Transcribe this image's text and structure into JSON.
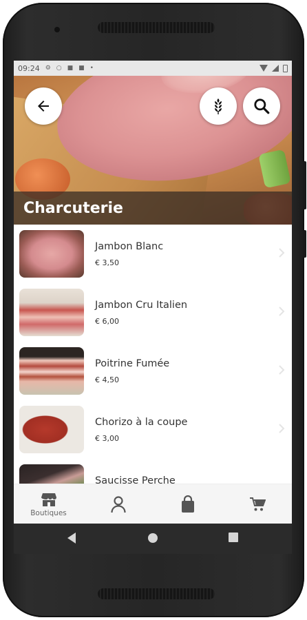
{
  "statusbar": {
    "time": "09:24",
    "icons": [
      "gear-icon",
      "circle-icon",
      "square-icon",
      "square-icon",
      "dot-icon"
    ]
  },
  "hero": {
    "title": "Charcuterie",
    "back_icon": "arrow-left-icon",
    "filter_icon": "wheat-icon",
    "search_icon": "search-icon"
  },
  "products": [
    {
      "name": "Jambon Blanc",
      "price": "€ 3,50"
    },
    {
      "name": "Jambon Cru Italien",
      "price": "€ 6,00"
    },
    {
      "name": "Poitrine Fumée",
      "price": "€ 4,50"
    },
    {
      "name": "Chorizo à la coupe",
      "price": "€ 3,00"
    },
    {
      "name": "Saucisse Perche",
      "price": ""
    }
  ],
  "bottom_nav": {
    "items": [
      {
        "label": "Boutiques",
        "icon": "store-icon"
      },
      {
        "label": "",
        "icon": "person-icon"
      },
      {
        "label": "",
        "icon": "shopping-bag-icon"
      },
      {
        "label": "",
        "icon": "cart-icon"
      }
    ]
  },
  "colors": {
    "accent_text": "#333333",
    "nav_bg": "#f5f5f5",
    "title_strip": "#322823"
  }
}
